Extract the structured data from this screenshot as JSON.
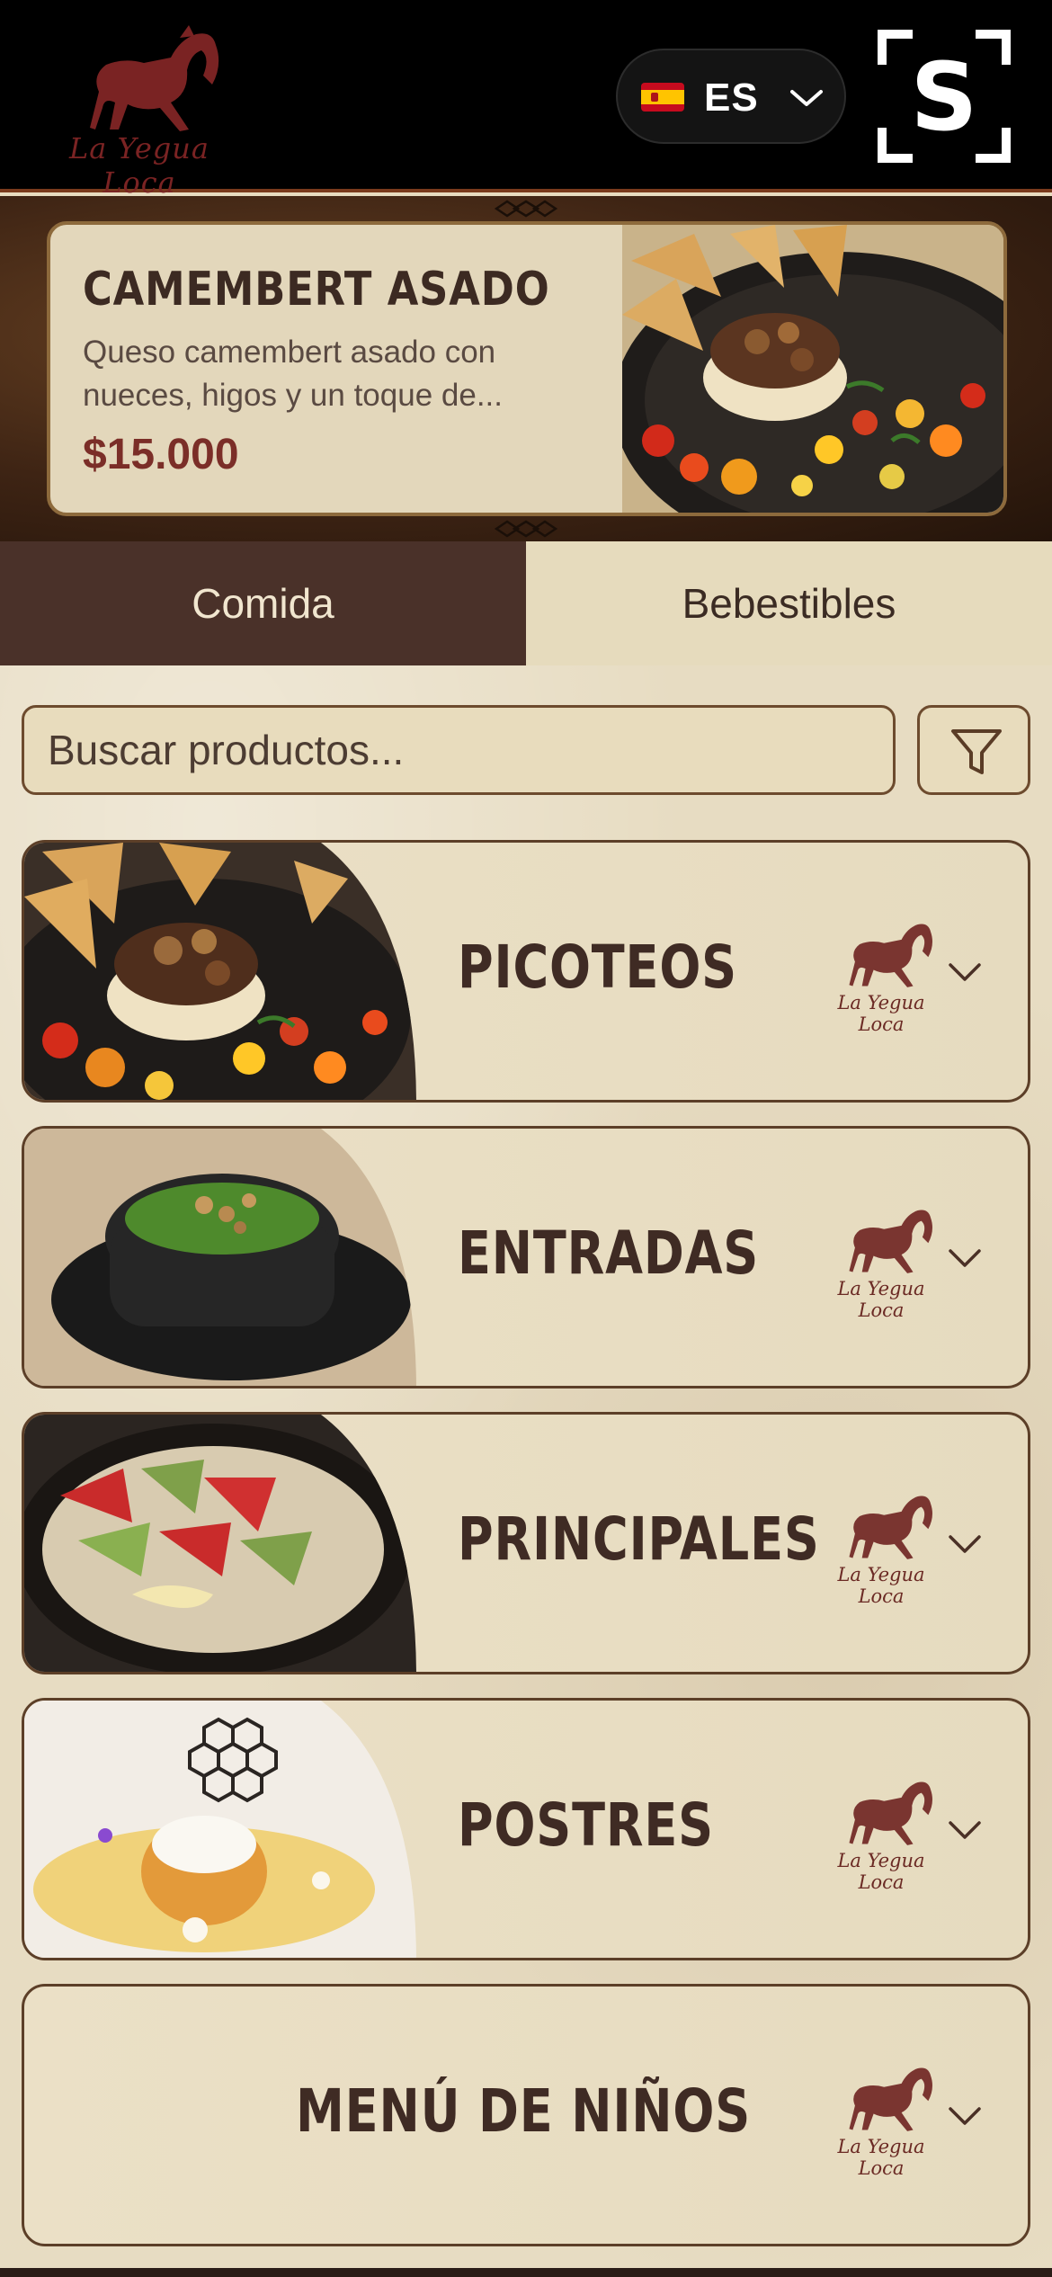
{
  "header": {
    "logo_text": "La Yegua Loca",
    "language": {
      "code": "ES",
      "flag": "spain-flag"
    },
    "scan_icon_letter": "S"
  },
  "featured": {
    "title": "CAMEMBERT ASADO",
    "description": "Queso camembert asado con nueces, higos y un toque de...",
    "price": "$15.000"
  },
  "tabs": [
    {
      "label": "Comida",
      "active": true
    },
    {
      "label": "Bebestibles",
      "active": false
    }
  ],
  "search": {
    "placeholder": "Buscar productos..."
  },
  "categories": [
    {
      "name": "PICOTEOS",
      "logo_text": "La Yegua Loca"
    },
    {
      "name": "ENTRADAS",
      "logo_text": "La Yegua Loca"
    },
    {
      "name": "PRINCIPALES",
      "logo_text": "La Yegua Loca"
    },
    {
      "name": "POSTRES",
      "logo_text": "La Yegua Loca"
    },
    {
      "name": "MENÚ DE NIÑOS",
      "logo_text": "La Yegua Loca"
    }
  ],
  "colors": {
    "header_bg": "#000000",
    "accent_brown": "#4a3129",
    "price_red": "#7b2e28",
    "card_bg": "#e6dbbf"
  }
}
